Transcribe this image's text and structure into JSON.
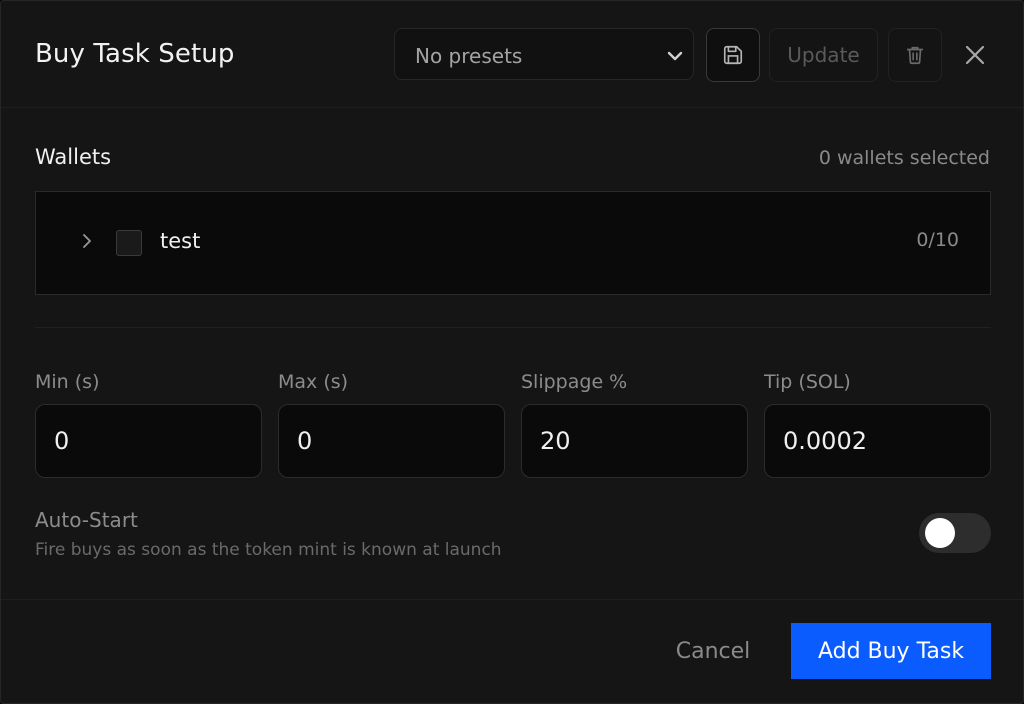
{
  "header": {
    "title": "Buy Task Setup",
    "preset_select": {
      "selected": "No presets",
      "icon": "chevron-down-icon"
    },
    "save_icon": "save-icon",
    "update_label": "Update",
    "delete_icon": "trash-icon",
    "close_icon": "close-icon"
  },
  "wallets": {
    "title": "Wallets",
    "selected_summary": "0 wallets selected",
    "groups": [
      {
        "name": "test",
        "ratio": "0/10",
        "expand_icon": "chevron-right-icon"
      }
    ]
  },
  "fields": {
    "min": {
      "label": "Min (s)",
      "value": "0"
    },
    "max": {
      "label": "Max (s)",
      "value": "0"
    },
    "slippage": {
      "label": "Slippage %",
      "value": "20"
    },
    "tip": {
      "label": "Tip (SOL)",
      "value": "0.0002"
    }
  },
  "auto_start": {
    "title": "Auto-Start",
    "description": "Fire buys as soon as the token mint is known at launch",
    "enabled": false
  },
  "footer": {
    "cancel_label": "Cancel",
    "submit_label": "Add Buy Task"
  },
  "colors": {
    "background": "#151515",
    "accent": "#0a5cff",
    "text_primary": "#f0f0f0",
    "text_muted": "#8c8c8c"
  }
}
